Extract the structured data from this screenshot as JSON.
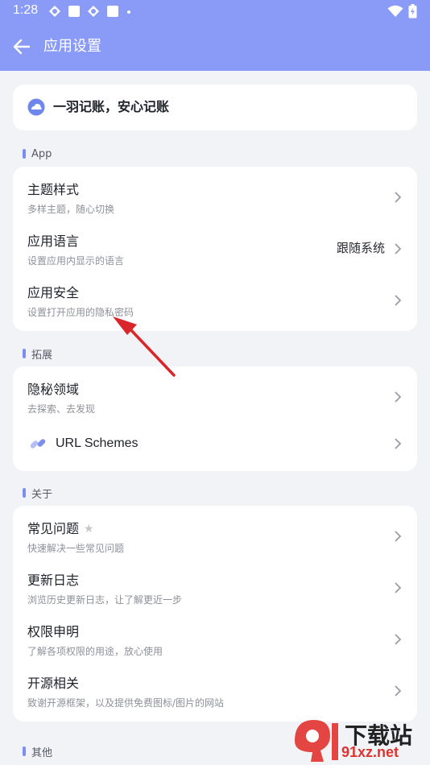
{
  "status_bar": {
    "time": "1:28"
  },
  "header": {
    "title": "应用设置"
  },
  "banner": {
    "text": "一羽记账，安心记账"
  },
  "sections": {
    "app": {
      "label": "App",
      "items": [
        {
          "title": "主题样式",
          "subtitle": "多样主题，随心切换"
        },
        {
          "title": "应用语言",
          "subtitle": "设置应用内显示的语言",
          "value": "跟随系统"
        },
        {
          "title": "应用安全",
          "subtitle": "设置打开应用的隐私密码"
        }
      ]
    },
    "extend": {
      "label": "拓展",
      "items": [
        {
          "title": "隐秘领域",
          "subtitle": "去探索、去发现"
        },
        {
          "title": "URL Schemes"
        }
      ]
    },
    "about": {
      "label": "关于",
      "items": [
        {
          "title": "常见问题",
          "subtitle": "快速解决一些常见问题"
        },
        {
          "title": "更新日志",
          "subtitle": "浏览历史更新日志，让了解更近一步"
        },
        {
          "title": "权限申明",
          "subtitle": "了解各项权限的用途，放心使用"
        },
        {
          "title": "开源相关",
          "subtitle": "致谢开源框架，以及提供免费图标/图片的网站"
        }
      ]
    },
    "other": {
      "label": "其他"
    }
  },
  "watermark": {
    "text": "下载站",
    "url": "91xz.net"
  },
  "colors": {
    "header_bg": "#8a9bf7",
    "page_bg": "#f2f3f7",
    "accent": "#7b8ff0",
    "annotation_arrow": "#d9262b"
  },
  "icons": [
    "wifi-icon",
    "battery-icon",
    "back-arrow-icon",
    "cloud-logo-icon",
    "link-icon",
    "chevron-right-icon",
    "star-icon"
  ]
}
